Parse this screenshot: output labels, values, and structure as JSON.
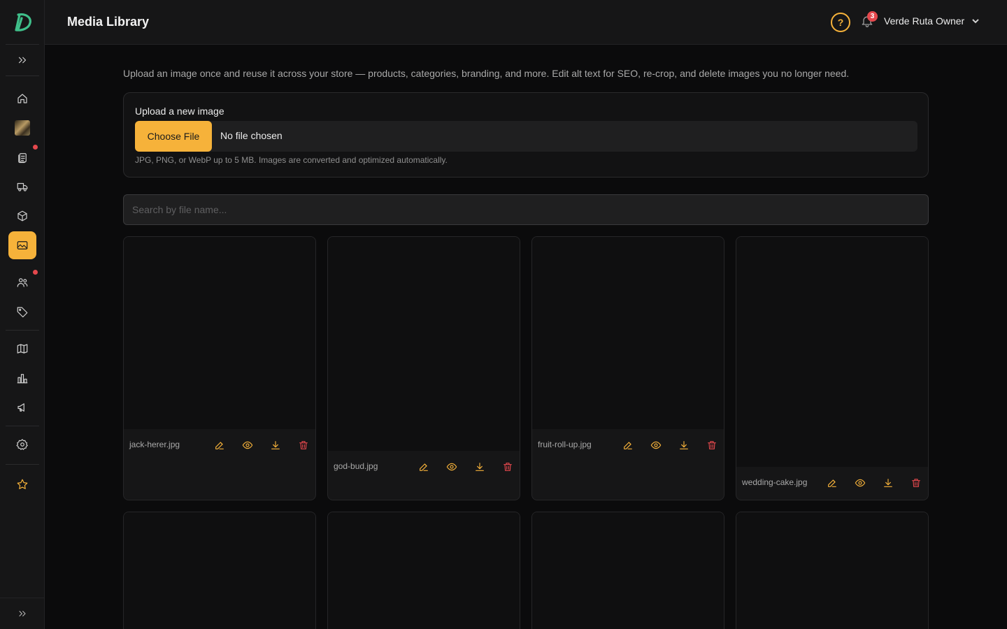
{
  "header": {
    "title": "Media Library",
    "help_label": "?",
    "notifications_count": "3",
    "user_name": "Verde Ruta Owner"
  },
  "sidebar": {
    "items": [
      {
        "name": "home"
      },
      {
        "name": "media-thumbnail"
      },
      {
        "name": "orders",
        "has_dot": true
      },
      {
        "name": "delivery"
      },
      {
        "name": "products"
      },
      {
        "name": "media-library",
        "active": true
      },
      {
        "name": "customers",
        "has_dot": true
      },
      {
        "name": "tags"
      },
      {
        "name": "catalog"
      },
      {
        "name": "analytics"
      },
      {
        "name": "marketing"
      },
      {
        "name": "settings"
      },
      {
        "name": "favorites"
      }
    ]
  },
  "main": {
    "intro": "Upload an image once and reuse it across your store — products, categories, branding, and more. Edit alt text for SEO, re-crop, and delete images you no longer need.",
    "upload": {
      "title": "Upload a new image",
      "choose_label": "Choose File",
      "file_status": "No file chosen",
      "hint": "JPG, PNG, or WebP up to 5 MB. Images are converted and optimized automatically."
    },
    "search": {
      "placeholder": "Search by file name..."
    },
    "images": [
      {
        "file_name": "jack-herer.jpg"
      },
      {
        "file_name": "god-bud.jpg"
      },
      {
        "file_name": "fruit-roll-up.jpg"
      },
      {
        "file_name": "wedding-cake.jpg"
      }
    ]
  },
  "colors": {
    "accent": "#f6b23a",
    "danger": "#e5484d",
    "background": "#0b0b0c",
    "surface": "#161617"
  }
}
